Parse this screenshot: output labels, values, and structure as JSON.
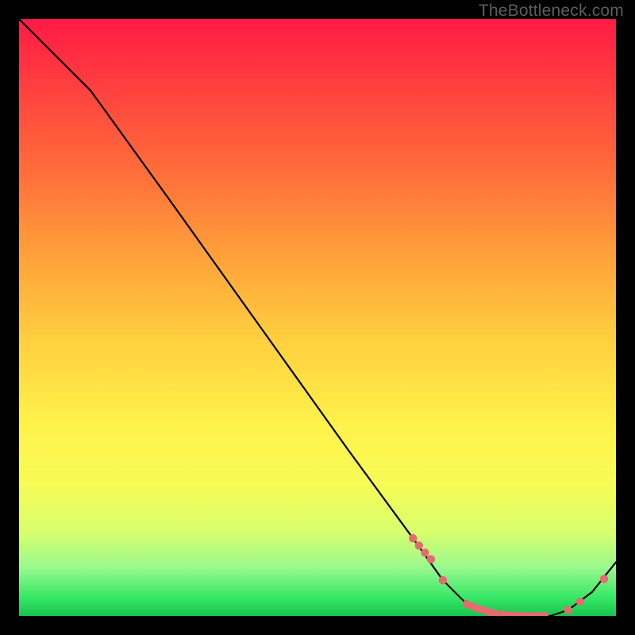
{
  "watermark": "TheBottleneck.com",
  "chart_data": {
    "type": "line",
    "title": "",
    "xlabel": "",
    "ylabel": "",
    "xlim": [
      0,
      100
    ],
    "ylim": [
      0,
      100
    ],
    "series": [
      {
        "name": "curve",
        "x": [
          0,
          6,
          12,
          25,
          40,
          55,
          66,
          71,
          75,
          80,
          85,
          89,
          92,
          96,
          100
        ],
        "y": [
          100,
          94,
          88,
          70,
          49,
          28,
          13,
          6,
          2,
          0,
          0,
          0,
          1,
          4,
          9
        ]
      }
    ],
    "markers": {
      "name": "highlight-dots",
      "color": "#e66a6f",
      "x": [
        66,
        67,
        68,
        69,
        71,
        75,
        76,
        77,
        78,
        79,
        80,
        81,
        82,
        83,
        84,
        85,
        86,
        87,
        88,
        92,
        94,
        98
      ],
      "y": [
        13,
        11.8,
        10.6,
        9.5,
        6.0,
        2.0,
        1.6,
        1.2,
        0.9,
        0.6,
        0.3,
        0.2,
        0.1,
        0.05,
        0.02,
        0,
        0,
        0,
        0,
        1.0,
        2.4,
        6.2
      ]
    }
  },
  "colors": {
    "background": "#000000",
    "curve": "#000000",
    "marker": "#e66a6f"
  }
}
